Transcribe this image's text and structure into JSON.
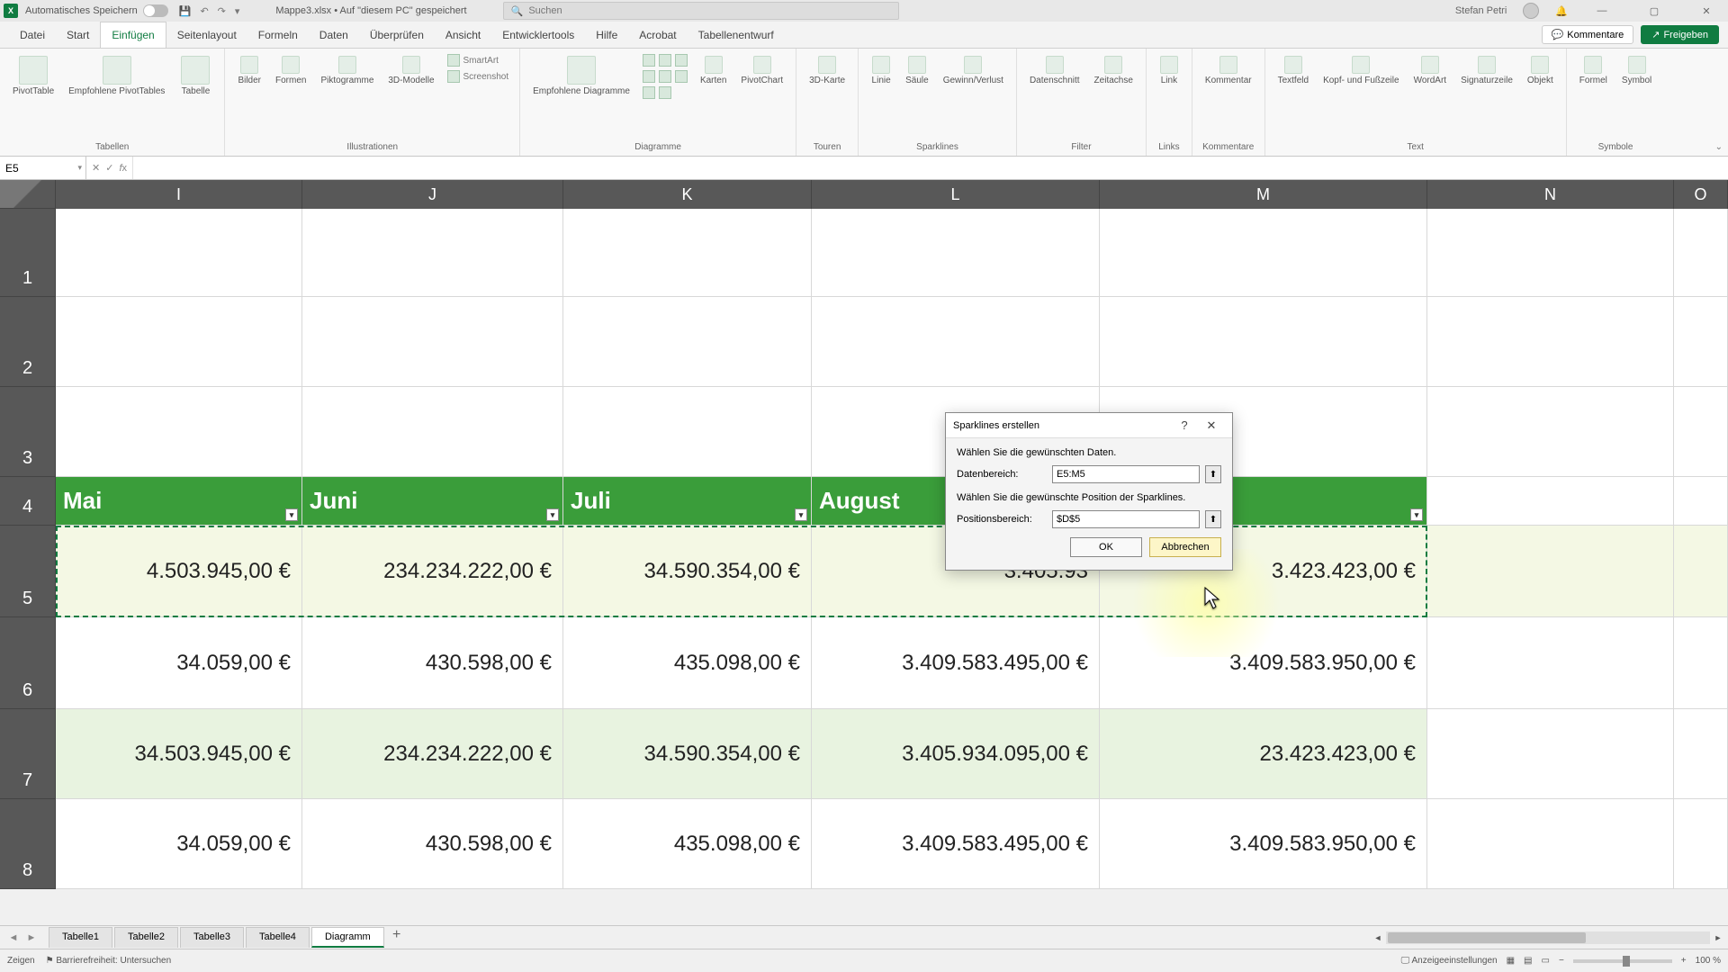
{
  "titlebar": {
    "autosave_label": "Automatisches Speichern",
    "filename": "Mappe3.xlsx • Auf \"diesem PC\" gespeichert",
    "search_placeholder": "Suchen",
    "username": "Stefan Petri"
  },
  "tabs": {
    "datei": "Datei",
    "start": "Start",
    "einfugen": "Einfügen",
    "seitenlayout": "Seitenlayout",
    "formeln": "Formeln",
    "daten": "Daten",
    "uberprufen": "Überprüfen",
    "ansicht": "Ansicht",
    "entwicklertools": "Entwicklertools",
    "hilfe": "Hilfe",
    "acrobat": "Acrobat",
    "tabellenentwurf": "Tabellenentwurf",
    "kommentare": "Kommentare",
    "freigeben": "Freigeben"
  },
  "ribbon": {
    "tabellen": {
      "label": "Tabellen",
      "pivot": "PivotTable",
      "empf": "Empfohlene PivotTables",
      "tabelle": "Tabelle"
    },
    "illustrationen": {
      "label": "Illustrationen",
      "bilder": "Bilder",
      "formen": "Formen",
      "piktogramme": "Piktogramme",
      "d3": "3D-Modelle",
      "smartart": "SmartArt",
      "screenshot": "Screenshot"
    },
    "diagramme": {
      "label": "Diagramme",
      "empf": "Empfohlene Diagramme",
      "karten": "Karten",
      "pivotchart": "PivotChart"
    },
    "touren": {
      "label": "Touren",
      "d3": "3D-Karte"
    },
    "sparklines": {
      "label": "Sparklines",
      "linie": "Linie",
      "saule": "Säule",
      "gewinn": "Gewinn/Verlust"
    },
    "filter": {
      "label": "Filter",
      "datenschnitt": "Datenschnitt",
      "zeitachse": "Zeitachse"
    },
    "links": {
      "label": "Links",
      "link": "Link"
    },
    "kommentare": {
      "label": "Kommentare",
      "kommentar": "Kommentar"
    },
    "text": {
      "label": "Text",
      "textfeld": "Textfeld",
      "kopf": "Kopf- und Fußzeile",
      "wordart": "WordArt",
      "signatur": "Signaturzeile",
      "objekt": "Objekt"
    },
    "symbole": {
      "label": "Symbole",
      "formel": "Formel",
      "symbol": "Symbol"
    }
  },
  "namebox": "E5",
  "columns": [
    "I",
    "J",
    "K",
    "L",
    "M",
    "N",
    "O"
  ],
  "row_numbers": [
    "1",
    "2",
    "3",
    "4",
    "5",
    "6",
    "7",
    "8"
  ],
  "headers": {
    "I": "Mai",
    "J": "Juni",
    "K": "Juli",
    "L": "August"
  },
  "grid": {
    "r5": {
      "I": "4.503.945,00 €",
      "J": "234.234.222,00 €",
      "K": "34.590.354,00 €",
      "L": "3.405.93",
      "M": "3.423.423,00 €"
    },
    "r6": {
      "I": "34.059,00 €",
      "J": "430.598,00 €",
      "K": "435.098,00 €",
      "L": "3.409.583.495,00 €",
      "M": "3.409.583.950,00 €"
    },
    "r7": {
      "I": "34.503.945,00 €",
      "J": "234.234.222,00 €",
      "K": "34.590.354,00 €",
      "L": "3.405.934.095,00 €",
      "M": "23.423.423,00 €"
    },
    "r8": {
      "I": "34.059,00 €",
      "J": "430.598,00 €",
      "K": "435.098,00 €",
      "L": "3.409.583.495,00 €",
      "M": "3.409.583.950,00 €"
    }
  },
  "dialog": {
    "title": "Sparklines erstellen",
    "hint1": "Wählen Sie die gewünschten Daten.",
    "data_label": "Datenbereich:",
    "data_value": "E5:M5",
    "hint2": "Wählen Sie die gewünschte Position der Sparklines.",
    "pos_label": "Positionsbereich:",
    "pos_value": "$D$5",
    "ok": "OK",
    "cancel": "Abbrechen"
  },
  "sheettabs": {
    "t1": "Tabelle1",
    "t2": "Tabelle2",
    "t3": "Tabelle3",
    "t4": "Tabelle4",
    "t5": "Diagramm"
  },
  "statusbar": {
    "mode": "Zeigen",
    "acc": "Barrierefreiheit: Untersuchen",
    "disp": "Anzeigeeinstellungen",
    "zoom": "100 %"
  }
}
